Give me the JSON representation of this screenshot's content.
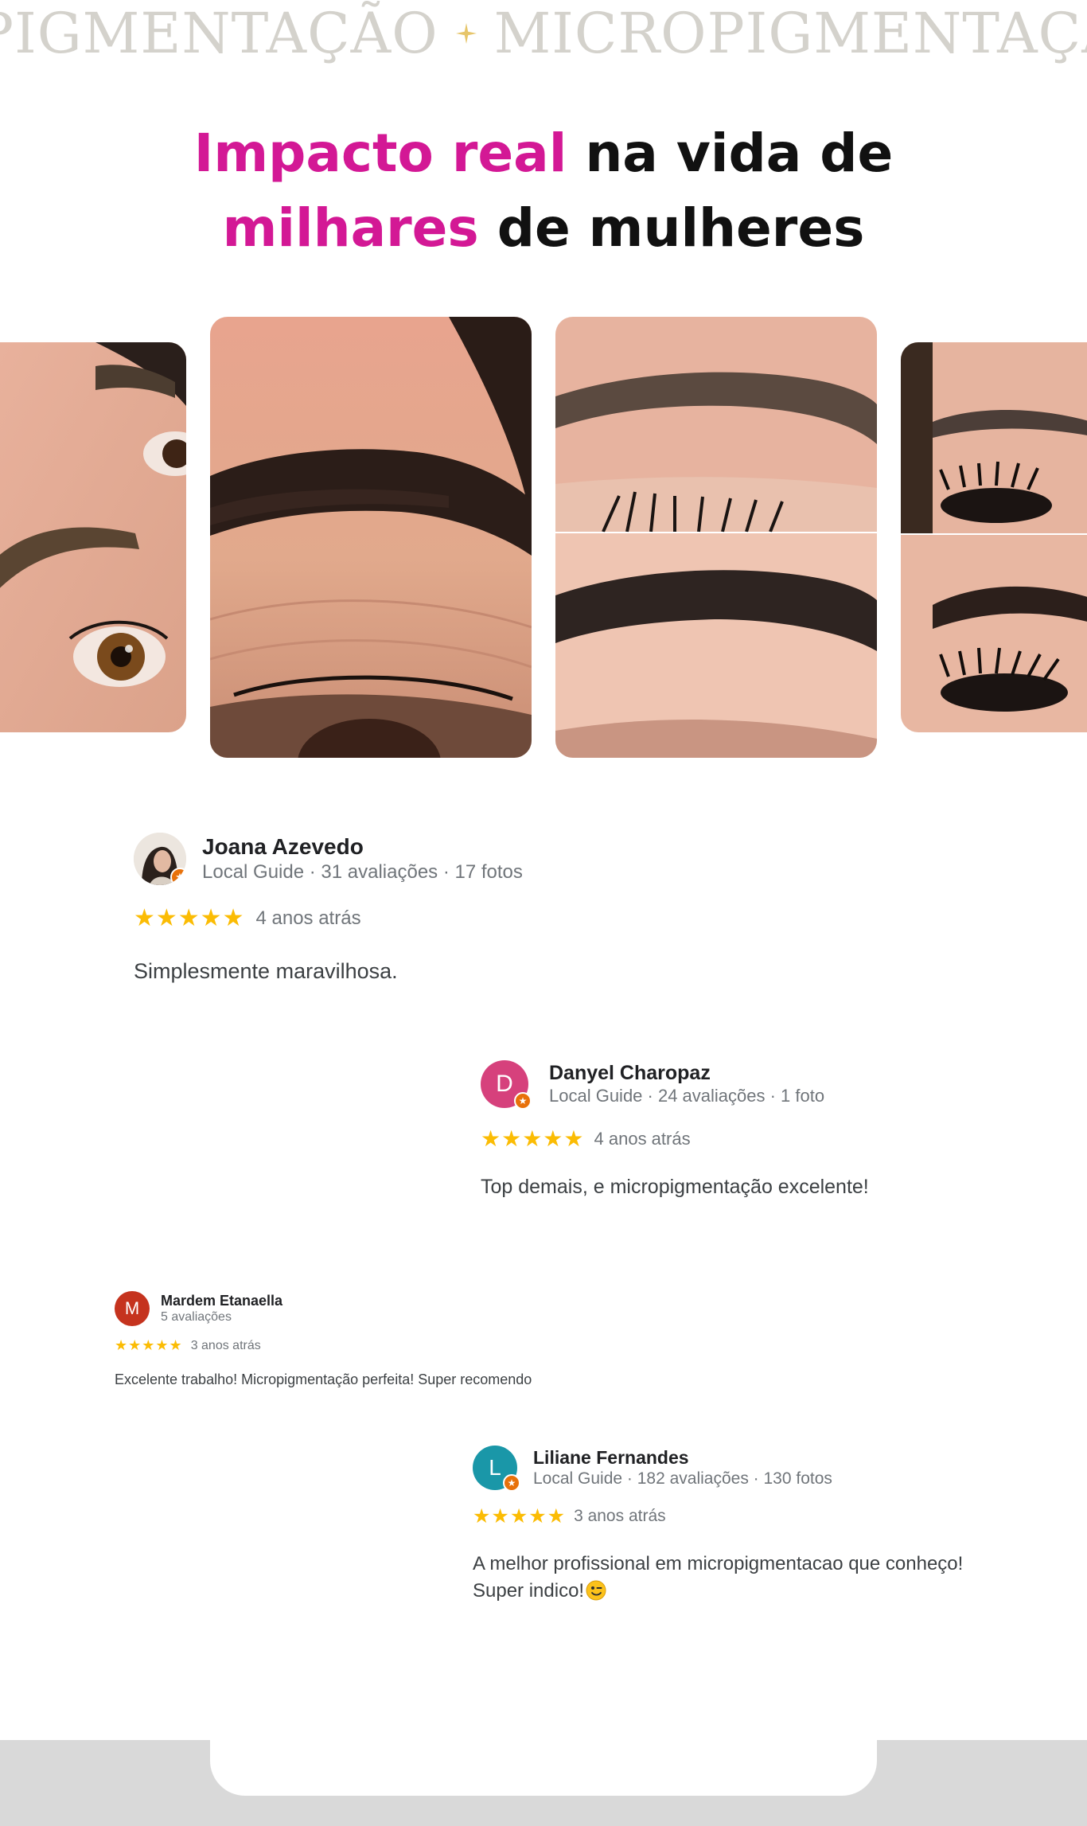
{
  "marquee": {
    "word": "MICROPIGMENTAÇÃO",
    "separator_icon": "sparkle-icon",
    "color": "#d4d2cc"
  },
  "heading": {
    "line1_highlight": "Impacto real",
    "line1_rest": " na vida de",
    "line2_highlight": "milhares",
    "line2_rest": " de mulheres",
    "highlight_color": "#d31895"
  },
  "gallery": {
    "photos": [
      "eyebrow-photo-left",
      "eyebrow-photo-closeup",
      "eyebrow-before-after",
      "eyebrow-lashes-right"
    ]
  },
  "reviews": [
    {
      "name": "Joana Azevedo",
      "meta": "Local Guide · 31 avaliações · 17 fotos",
      "stars": "★★★★★",
      "time": "4 anos atrás",
      "text": "Simplesmente maravilhosa.",
      "avatar": "photo"
    },
    {
      "name": "Danyel Charopaz",
      "meta": "Local Guide · 24 avaliações · 1 foto",
      "stars": "★★★★★",
      "time": "4 anos atrás",
      "text": "Top demais, e micropigmentação excelente!",
      "avatar_letter": "D",
      "avatar_color": "#d6417c"
    },
    {
      "name": "Mardem Etanaella",
      "meta": "5 avaliações",
      "stars": "★★★★★",
      "time": "3 anos atrás",
      "text": "Excelente trabalho! Micropigmentação perfeita! Super recomendo",
      "avatar_letter": "M",
      "avatar_color": "#c5331e"
    },
    {
      "name": "Liliane Fernandes",
      "meta": "Local Guide · 182 avaliações · 130 fotos",
      "stars": "★★★★★",
      "time": "3 anos atrás",
      "text": "A melhor profissional em micropigmentacao que conheço! Super indico!",
      "avatar_letter": "L",
      "avatar_color": "#1a97a8",
      "emoji": "winking-face-emoji"
    }
  ],
  "colors": {
    "star": "#fbbc04",
    "local_guide_badge": "#e8710a",
    "footer_band": "#d9d9d9"
  }
}
